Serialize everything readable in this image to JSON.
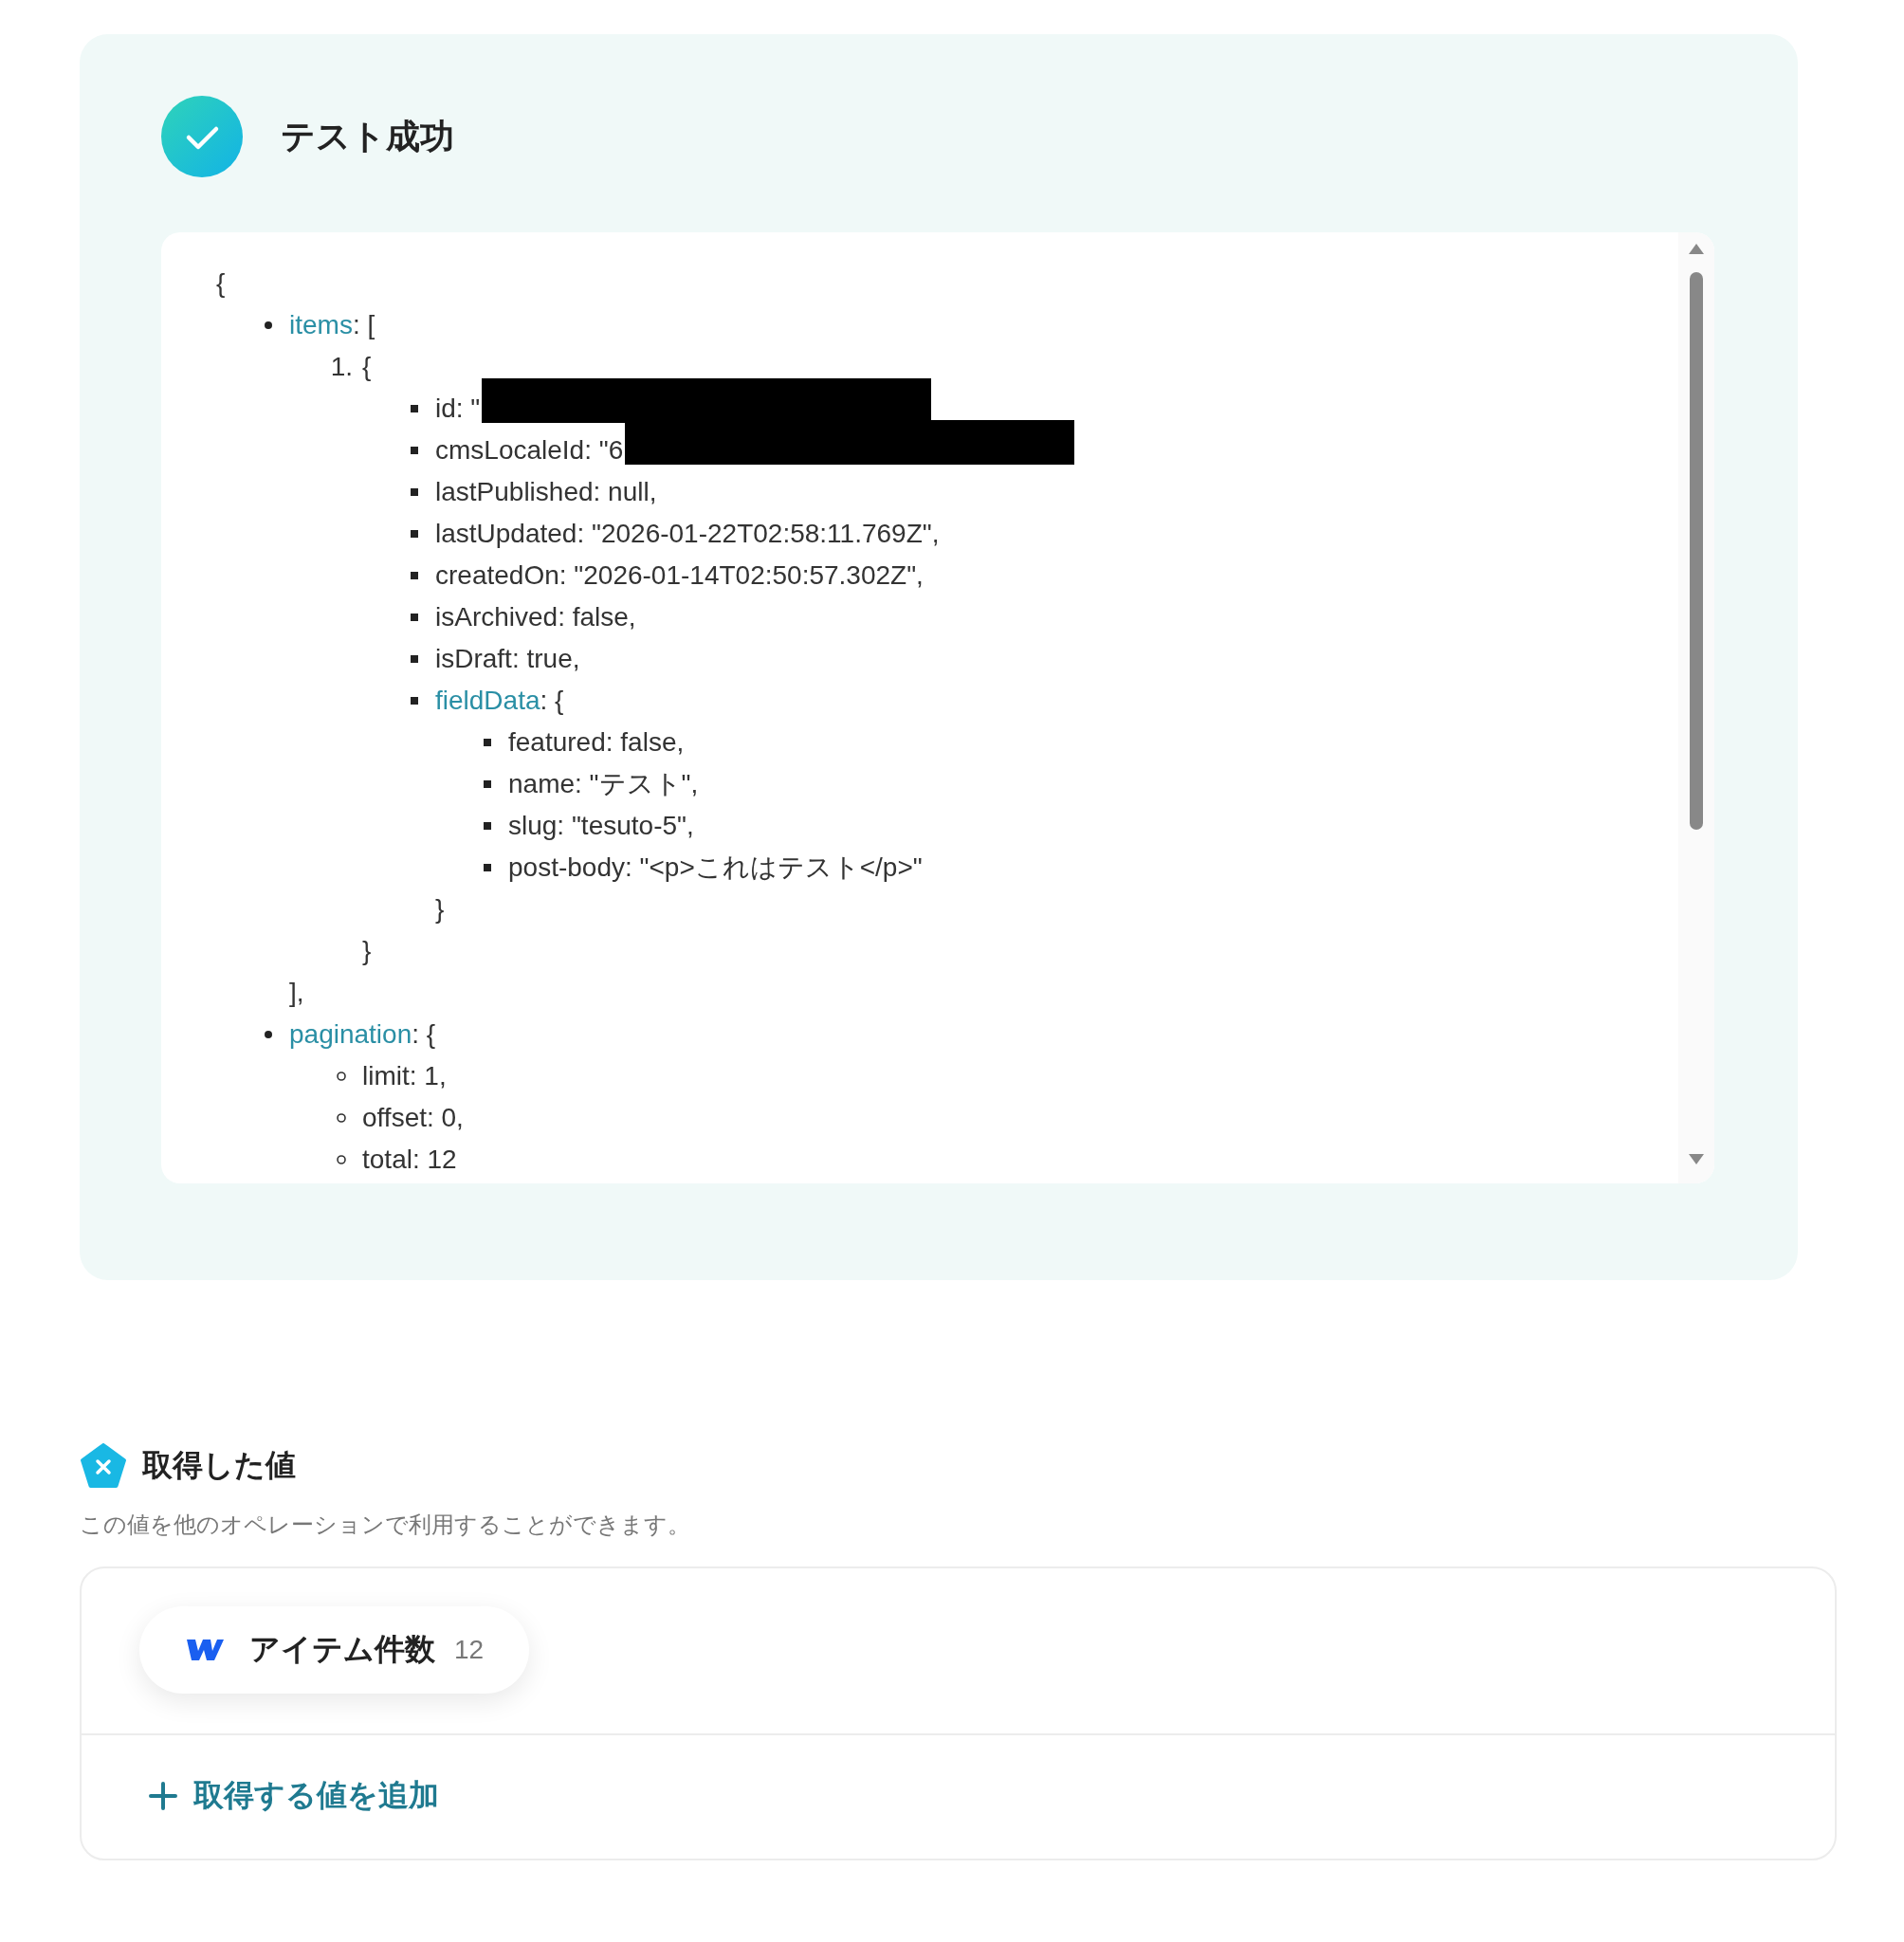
{
  "test_result": {
    "title": "テスト成功",
    "output": {
      "text": "{",
      "children": [
        {
          "kind": "disc",
          "key": "items",
          "text": ": [",
          "close": "],",
          "children": [
            {
              "kind": "number",
              "label": "1.",
              "text": "{",
              "close": "}",
              "children": [
                {
                  "kind": "square",
                  "text": "id: \"",
                  "redacted": true
                },
                {
                  "kind": "square",
                  "text": "cmsLocaleId: \"6",
                  "redacted": true
                },
                {
                  "kind": "square",
                  "text": "lastPublished: null,"
                },
                {
                  "kind": "square",
                  "text": "lastUpdated: \"2026-01-22T02:58:11.769Z\","
                },
                {
                  "kind": "square",
                  "text": "createdOn: \"2026-01-14T02:50:57.302Z\","
                },
                {
                  "kind": "square",
                  "text": "isArchived: false,"
                },
                {
                  "kind": "square",
                  "text": "isDraft: true,"
                },
                {
                  "kind": "square",
                  "key": "fieldData",
                  "text": ": {",
                  "close": "}",
                  "children": [
                    {
                      "kind": "square",
                      "text": "featured: false,"
                    },
                    {
                      "kind": "square",
                      "text": "name: \"テスト\","
                    },
                    {
                      "kind": "square",
                      "text": "slug: \"tesuto-5\","
                    },
                    {
                      "kind": "square",
                      "text": "post-body: \"<p>これはテスト</p>\""
                    }
                  ]
                }
              ]
            }
          ]
        },
        {
          "kind": "disc",
          "key": "pagination",
          "text": ": {",
          "children": [
            {
              "kind": "circle",
              "text": "limit: 1,"
            },
            {
              "kind": "circle",
              "text": "offset: 0,"
            },
            {
              "kind": "circle",
              "text": "total: 12"
            }
          ]
        }
      ]
    }
  },
  "acquired_values": {
    "title": "取得した値",
    "description": "この値を他のオペレーションで利用することができます。",
    "values": [
      {
        "label": "アイテム件数",
        "value": "12"
      }
    ],
    "add_button": "取得する値を追加"
  }
}
